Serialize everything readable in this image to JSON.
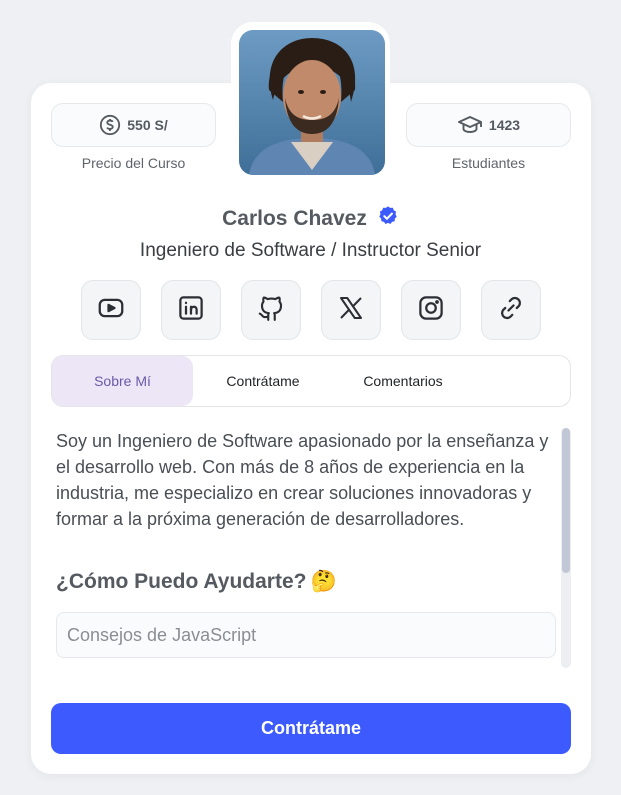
{
  "profile": {
    "name": "Carlos Chavez",
    "title": "Ingeniero de Software / Instructor Senior",
    "verified": true
  },
  "stats": {
    "price": {
      "value": "550 S/",
      "label": "Precio del Curso",
      "icon": "dollar-circle-icon"
    },
    "students": {
      "value": "1423",
      "label": "Estudiantes",
      "icon": "graduation-cap-icon"
    }
  },
  "social": [
    {
      "name": "youtube",
      "icon": "youtube-icon"
    },
    {
      "name": "linkedin",
      "icon": "linkedin-icon"
    },
    {
      "name": "github",
      "icon": "github-icon"
    },
    {
      "name": "x",
      "icon": "x-icon"
    },
    {
      "name": "instagram",
      "icon": "instagram-icon"
    },
    {
      "name": "link",
      "icon": "link-icon"
    }
  ],
  "tabs": [
    {
      "label": "Sobre Mí",
      "active": true
    },
    {
      "label": "Contrátame",
      "active": false
    },
    {
      "label": "Comentarios",
      "active": false
    }
  ],
  "about": {
    "text": "Soy un Ingeniero de Software apasionado por la enseñanza y el desarrollo web. Con más de 8 años de experiencia en la industria, me especializo en crear soluciones innovadoras y formar a la próxima generación de desarrolladores.",
    "help_title": "¿Cómo Puedo Ayudarte?",
    "help_emoji": "🤔",
    "services": [
      "Consejos de JavaScript"
    ]
  },
  "cta": {
    "label": "Contrátame"
  },
  "colors": {
    "accent": "#3d5afe",
    "active_tab_bg": "#ece6f7",
    "active_tab_text": "#6b5aa8",
    "verified_badge": "#3d5afe"
  }
}
